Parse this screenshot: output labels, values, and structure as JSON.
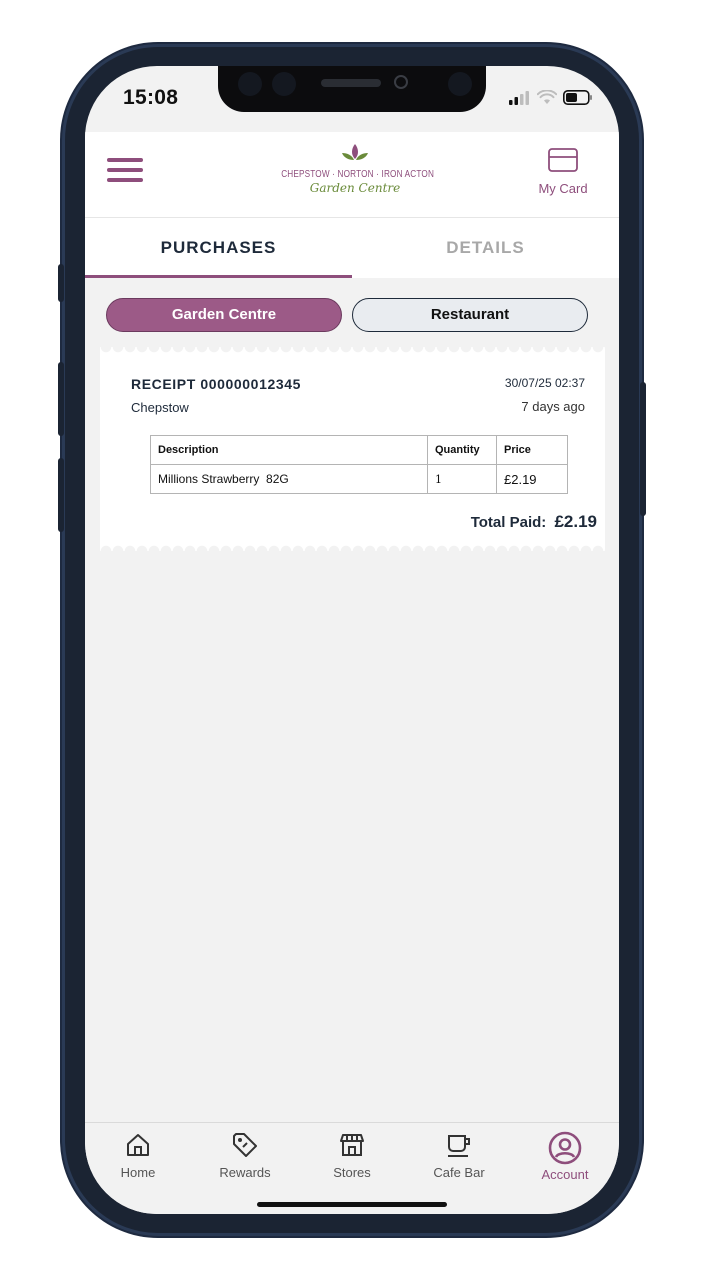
{
  "status_bar": {
    "time": "15:08"
  },
  "header": {
    "logo_line1": "CHEPSTOW · NORTON · IRON ACTON",
    "logo_line2": "Garden Centre",
    "my_card_label": "My Card",
    "menu_icon": "hamburger-icon",
    "card_icon": "card-icon"
  },
  "tabs": [
    {
      "label": "PURCHASES",
      "active": true
    },
    {
      "label": "DETAILS",
      "active": false
    }
  ],
  "segments": [
    {
      "label": "Garden Centre",
      "active": true
    },
    {
      "label": "Restaurant",
      "active": false
    }
  ],
  "receipt": {
    "number": "RECEIPT 000000012345",
    "store": "Chepstow",
    "date": "30/07/25 02:37",
    "ago": "7 days ago",
    "columns": [
      "Description",
      "Quantity",
      "Price"
    ],
    "items": [
      {
        "description": "Millions Strawberry  82G",
        "quantity": "1",
        "price": "£2.19"
      }
    ],
    "total_label": "Total Paid:",
    "total_amount": "£2.19"
  },
  "bottom_nav": [
    {
      "label": "Home",
      "icon": "home-icon",
      "active": false
    },
    {
      "label": "Rewards",
      "icon": "tag-icon",
      "active": false
    },
    {
      "label": "Stores",
      "icon": "store-icon",
      "active": false
    },
    {
      "label": "Cafe Bar",
      "icon": "coffee-cup-icon",
      "active": false
    },
    {
      "label": "Account",
      "icon": "account-icon",
      "active": true
    }
  ],
  "colors": {
    "brand": "#8e4e7c",
    "segment_active": "#9c5a87",
    "dark_text": "#1e2a3a",
    "logo_green": "#6a8b3a"
  }
}
